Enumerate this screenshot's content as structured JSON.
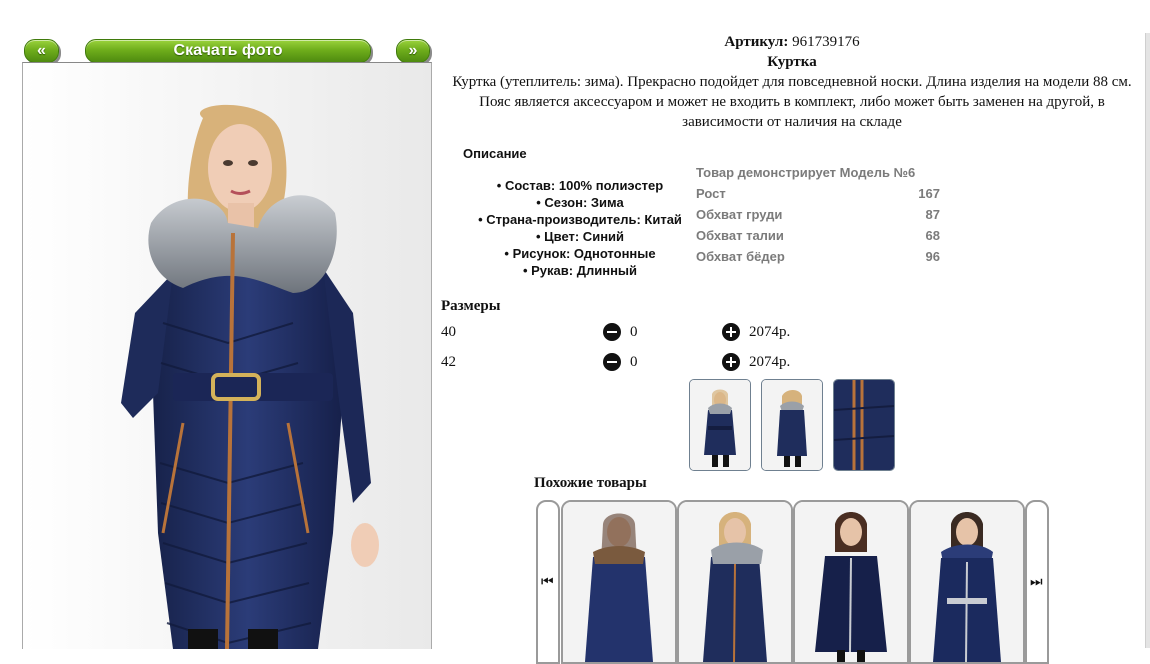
{
  "nav": {
    "prev_label": "«",
    "download_label": "Скачать фото",
    "next_label": "»"
  },
  "product": {
    "sku_label": "Артикул:",
    "sku_value": "961739176",
    "title": "Куртка",
    "description": "Куртка (утеплитель: зима). Прекрасно подойдет для повседневной носки. Длина изделия на модели 88 см. Пояс является аксессуаром и может не входить в комплект, либо может быть заменен на другой, в зависимости от наличия на складе"
  },
  "details": {
    "heading": "Описание",
    "attributes": [
      "Состав: 100% полиэстер",
      "Сезон: Зима",
      "Страна-производитель: Китай",
      "Цвет: Синий",
      "Рисунок: Однотонные",
      "Рукав: Длинный"
    ]
  },
  "model": {
    "heading": "Товар демонстрирует Модель №6",
    "rows": [
      {
        "label": "Рост",
        "value": "167"
      },
      {
        "label": "Обхват груди",
        "value": "87"
      },
      {
        "label": "Обхват талии",
        "value": "68"
      },
      {
        "label": "Обхват бёдер",
        "value": "96"
      }
    ]
  },
  "sizes": {
    "heading": "Размеры",
    "rows": [
      {
        "size": "40",
        "qty": "0",
        "price": "2074р."
      },
      {
        "size": "42",
        "qty": "0",
        "price": "2074р."
      }
    ]
  },
  "similar": {
    "heading": "Похожие товары",
    "prev_icon": "skip-back-icon",
    "next_icon": "skip-forward-icon"
  },
  "colors": {
    "accent_green": "#6fae1c",
    "jacket_navy": "#1f2d5c"
  }
}
